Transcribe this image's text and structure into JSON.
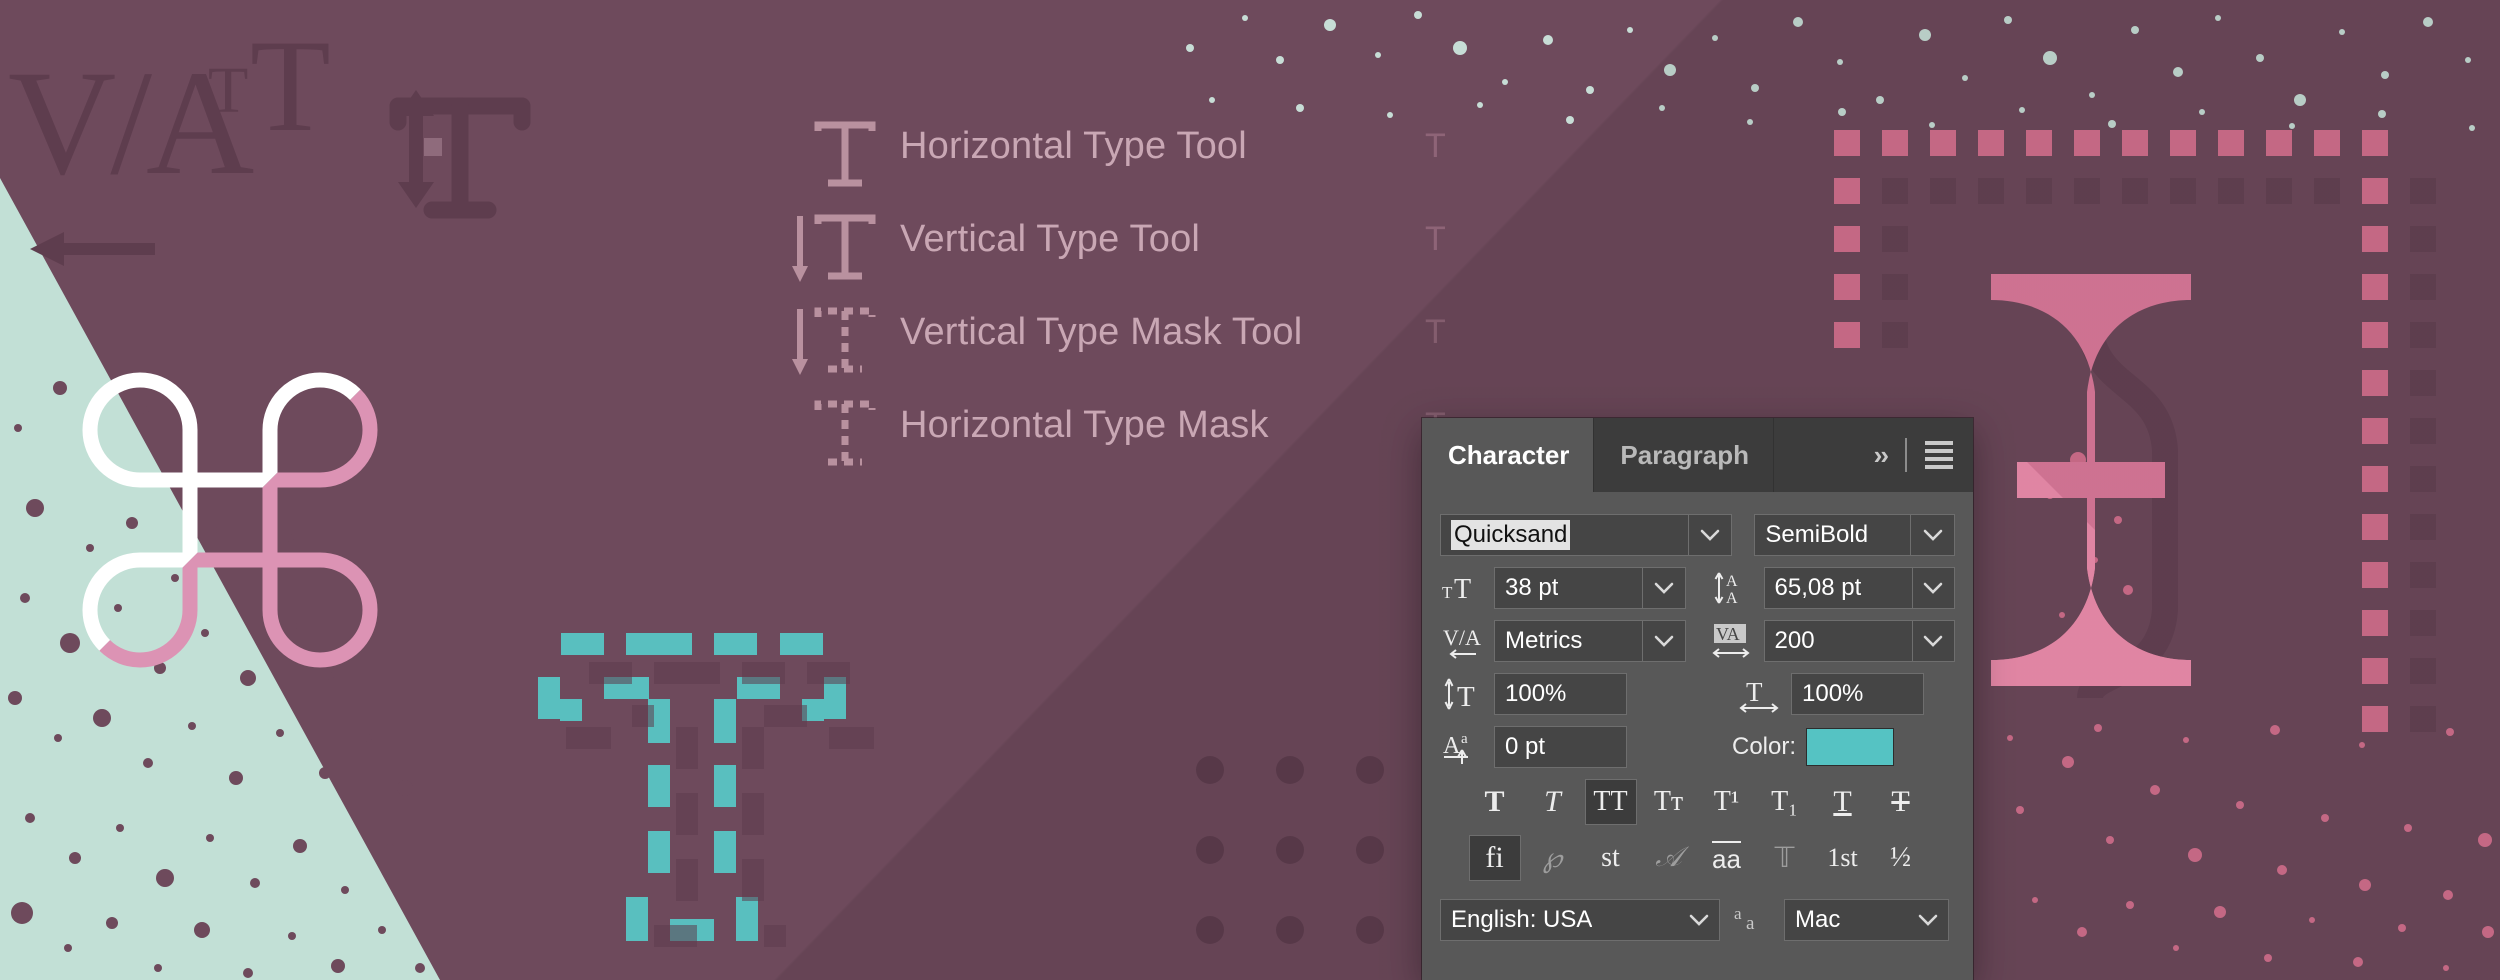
{
  "canvas": {
    "background_color": "#6E4A5C",
    "mint_color": "#C2E0D6",
    "pink_color": "#D4708F",
    "teal_color": "#59BFBF",
    "white_color": "#FFFFFF"
  },
  "tool_menu": {
    "items": [
      {
        "label": "Horizontal Type Tool",
        "shortcut": "T",
        "icon": "horizontal-type-icon"
      },
      {
        "label": "Vertical Type Tool",
        "shortcut": "T",
        "icon": "vertical-type-icon"
      },
      {
        "label": "Vertical Type Mask Tool",
        "shortcut": "T",
        "icon": "vertical-type-mask-icon"
      },
      {
        "label": "Horizontal Type Mask",
        "shortcut": "T",
        "icon": "horizontal-type-mask-icon"
      }
    ]
  },
  "character_panel": {
    "tabs": [
      {
        "label": "Character",
        "active": true
      },
      {
        "label": "Paragraph",
        "active": false
      }
    ],
    "expand_label": "››",
    "menu_icon": "hamburger-icon",
    "font_family": {
      "value": "Quicksand",
      "selected": true
    },
    "font_style": {
      "value": "SemiBold"
    },
    "font_size": {
      "icon": "font-size-icon",
      "value": "38 pt"
    },
    "leading": {
      "icon": "leading-icon",
      "value": "65,08 pt"
    },
    "kerning": {
      "icon": "kerning-icon",
      "value": "Metrics"
    },
    "tracking": {
      "icon": "tracking-icon",
      "value": "200"
    },
    "vertical_scale": {
      "icon": "vertical-scale-icon",
      "value": "100%"
    },
    "horizontal_scale": {
      "icon": "horizontal-scale-icon",
      "value": "100%"
    },
    "baseline_shift": {
      "icon": "baseline-shift-icon",
      "value": "0 pt"
    },
    "color": {
      "label": "Color:",
      "value": "#55C3C3"
    },
    "style_buttons": [
      {
        "name": "faux-bold",
        "glyph": "T",
        "active": false
      },
      {
        "name": "faux-italic",
        "glyph": "T",
        "active": false
      },
      {
        "name": "all-caps",
        "glyph": "TT",
        "active": true
      },
      {
        "name": "small-caps",
        "glyph": "Tᴛ",
        "active": false
      },
      {
        "name": "superscript",
        "glyph": "T¹",
        "active": false
      },
      {
        "name": "subscript",
        "glyph": "T₁",
        "active": false
      },
      {
        "name": "underline",
        "glyph": "T",
        "active": false
      },
      {
        "name": "strikethrough",
        "glyph": "T",
        "active": false
      }
    ],
    "opentype_buttons": [
      {
        "name": "standard-ligatures",
        "glyph": "fi",
        "active": true
      },
      {
        "name": "contextual-alternates",
        "glyph": "℘",
        "active": false
      },
      {
        "name": "discretionary-ligatures",
        "glyph": "st",
        "active": false
      },
      {
        "name": "swash",
        "glyph": "𝒜",
        "active": false
      },
      {
        "name": "stylistic-alternates",
        "glyph": "aа",
        "active": false
      },
      {
        "name": "titling-alternates",
        "glyph": "𝕋",
        "active": false
      },
      {
        "name": "ordinals",
        "glyph": "1st",
        "active": false
      },
      {
        "name": "fractions",
        "glyph": "½",
        "active": false
      }
    ],
    "language": {
      "value": "English: USA"
    },
    "antialias": {
      "icon": "anti-alias-icon",
      "value": "Mac"
    }
  }
}
